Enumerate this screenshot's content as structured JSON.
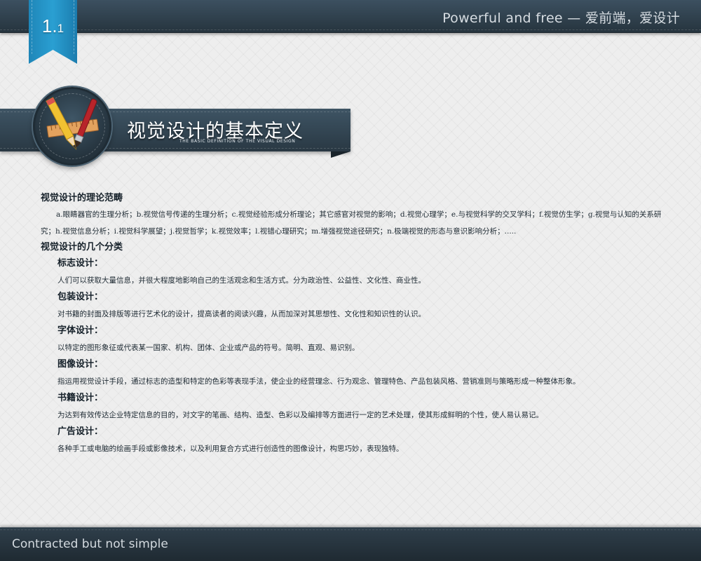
{
  "header": {
    "slide_number_main": "1.",
    "slide_number_sub": "1",
    "tagline": "Powerful and free — 爱前端，爱设计"
  },
  "section": {
    "title": "视觉设计的基本定义",
    "subtitle": "THE BASIC DEFINITION OF THE VISUAL DESIGN",
    "icon": "design-tools-icon"
  },
  "theory": {
    "heading": "视觉设计的理论范畴",
    "text": "a.眼睛器官的生理分析；b.视觉信号传递的生理分析；c.视觉经验形成分析理论；其它感官对视觉的影响；d.视觉心理学；e.与视觉科学的交叉学科；f.视觉仿生学；g.视觉与认知的关系研究；h.视觉信息分析；i.视觉科学展望；j.视觉哲学；k.视觉效率；l.视错心理研究；m.增强视觉途径研究；n.极端视觉的形态与意识影响分析；....."
  },
  "categories_heading": "视觉设计的几个分类",
  "categories": [
    {
      "title": "标志设计：",
      "desc": "人们可以获取大量信息，并很大程度地影响自己的生活观念和生活方式。分为政治性、公益性、文化性、商业性。"
    },
    {
      "title": "包装设计：",
      "desc": "对书籍的封面及排版等进行艺术化的设计，提高读者的阅读兴趣，从而加深对其思想性、文化性和知识性的认识。"
    },
    {
      "title": "字体设计：",
      "desc": "以特定的图形象征或代表某一国家、机构、团体、企业或产品的符号。简明、直观、易识别。"
    },
    {
      "title": "图像设计：",
      "desc": "指运用视觉设计手段，通过标志的造型和特定的色彩等表现手法，使企业的经营理念、行为观念、管理特色、产品包装风格、营销准则与策略形成一种整体形象。"
    },
    {
      "title": "书籍设计：",
      "desc": "为达到有效传达企业特定信息的目的，对文字的笔画、结构、造型、色彩以及编排等方面进行一定的艺术处理，使其形成鲜明的个性，使人易认易记。"
    },
    {
      "title": "广告设计：",
      "desc": "各种手工或电脑的绘画手段或影像技术，以及利用复合方式进行创造性的图像设计，构思巧妙，表现独特。"
    }
  ],
  "footer": {
    "text": "Contracted but not simple"
  }
}
